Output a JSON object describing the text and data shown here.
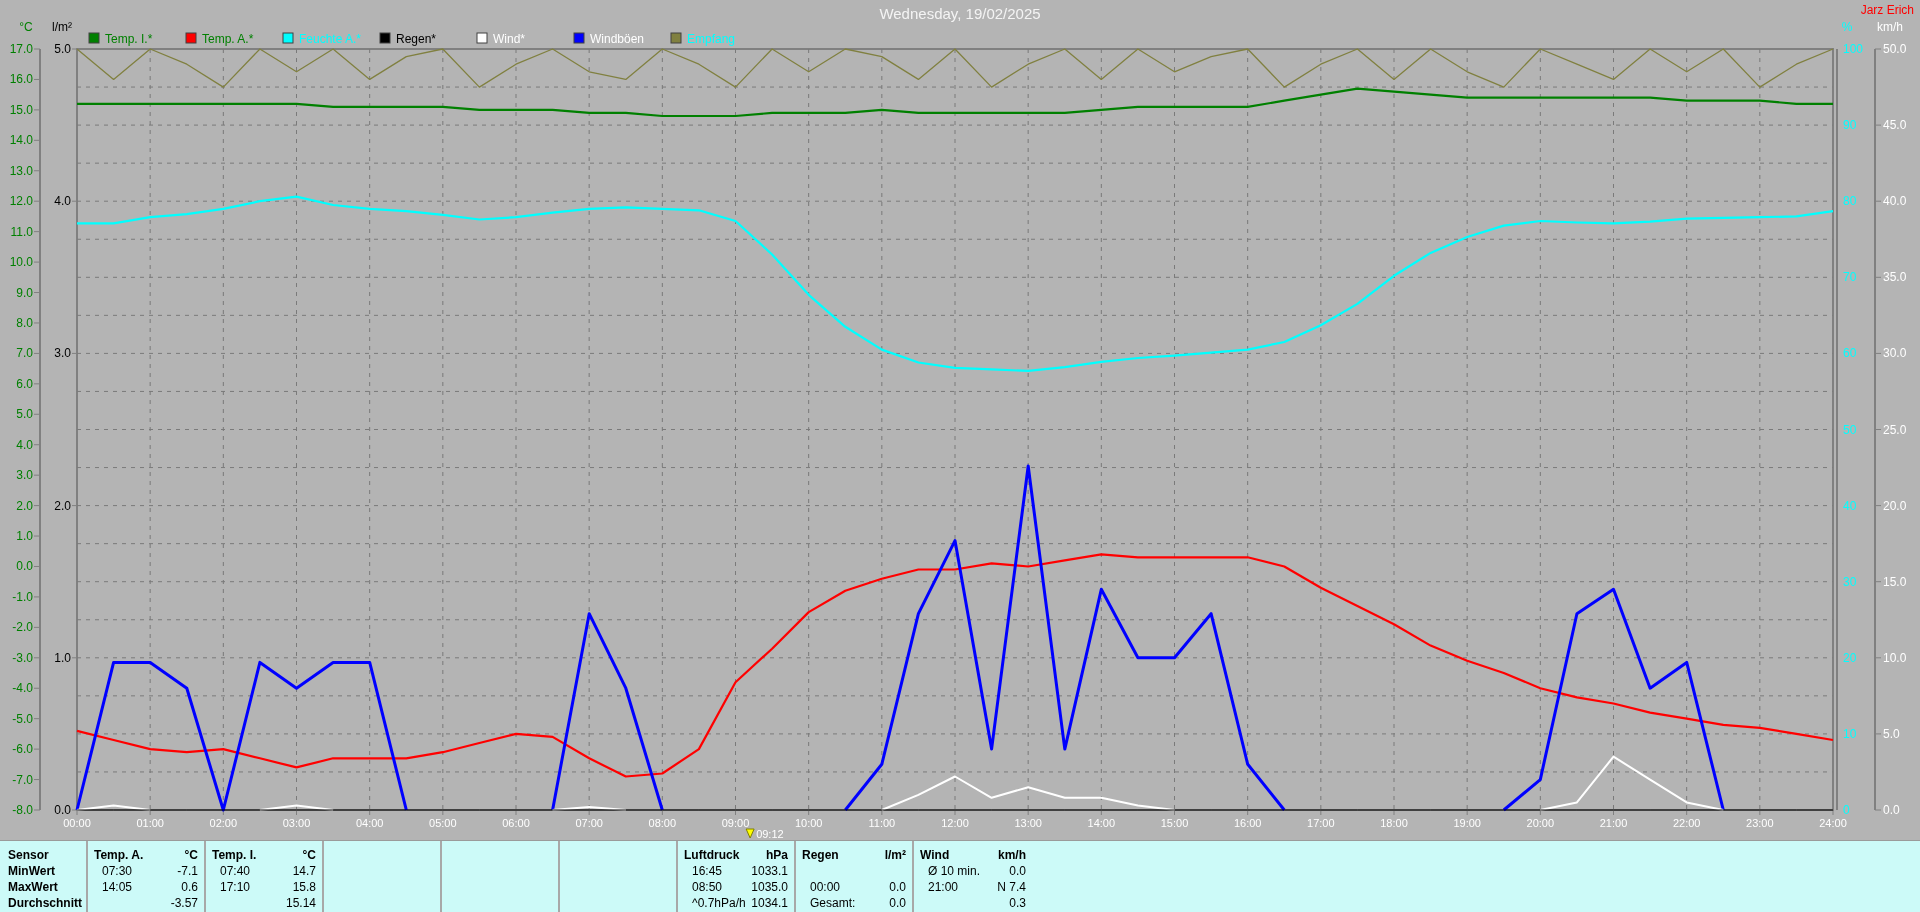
{
  "title": "Wednesday, 19/02/2025",
  "author": "Jarz Erich",
  "chart": {
    "legend": [
      {
        "color": "#008000"
      },
      {
        "color": "#008000"
      },
      {
        "color": "#00ffff"
      },
      {
        "color": "#000000"
      },
      {
        "color": "#ffffff"
      },
      {
        "color": "#ffffff"
      },
      {
        "color": "#00ffff"
      }
    ],
    "rain_axis": {
      "label": "l/m²",
      "ticks": [
        "5.0",
        "4.0",
        "3.0",
        "2.0",
        "1.0",
        "0.0"
      ]
    },
    "chart_data": {
      "type": "line",
      "ylabel": "°C",
      "ylim": [
        -8,
        17
      ],
      "yticks": [
        {
          "value": 17,
          "label": "17.0"
        },
        {
          "value": 16,
          "label": "16.0"
        },
        {
          "value": 15,
          "label": "15.0"
        },
        {
          "value": 14,
          "label": "14.0"
        },
        {
          "value": 13,
          "label": "13.0"
        },
        {
          "value": 12,
          "label": "12.0"
        },
        {
          "value": 11,
          "label": "11.0"
        },
        {
          "value": 10,
          "label": "10.0"
        },
        {
          "value": 9,
          "label": "9.0"
        },
        {
          "value": 8,
          "label": "8.0"
        },
        {
          "value": 7,
          "label": "7.0"
        },
        {
          "value": 6,
          "label": "6.0"
        },
        {
          "value": 5,
          "label": "5.0"
        },
        {
          "value": 4,
          "label": "4.0"
        },
        {
          "value": 3,
          "label": "3.0"
        },
        {
          "value": 2,
          "label": "2.0"
        },
        {
          "value": 1,
          "label": "1.0"
        },
        {
          "value": 0,
          "label": "0.0"
        },
        {
          "value": -1,
          "label": "-1.0"
        },
        {
          "value": -2,
          "label": "-2.0"
        },
        {
          "value": -3,
          "label": "-3.0"
        },
        {
          "value": -4,
          "label": "-4.0"
        },
        {
          "value": -5,
          "label": "-5.0"
        },
        {
          "value": -6,
          "label": "-6.0"
        },
        {
          "value": -7,
          "label": "-7.0"
        },
        {
          "value": -8,
          "label": "-8.0"
        }
      ],
      "y2label": "%",
      "y2lim": [
        0,
        100
      ],
      "y2ticks": [
        {
          "value": 100,
          "label": "100"
        },
        {
          "value": 90,
          "label": "90"
        },
        {
          "value": 80,
          "label": "80"
        },
        {
          "value": 70,
          "label": "70"
        },
        {
          "value": 60,
          "label": "60"
        },
        {
          "value": 50,
          "label": "50"
        },
        {
          "value": 40,
          "label": "40"
        },
        {
          "value": 30,
          "label": "30"
        },
        {
          "value": 20,
          "label": "20"
        },
        {
          "value": 10,
          "label": "10"
        },
        {
          "value": 0,
          "label": "0"
        }
      ],
      "y3label": "km/h",
      "y3lim": [
        0,
        50
      ],
      "y3ticks": [
        {
          "value": 50,
          "label": "50.0"
        },
        {
          "value": 45,
          "label": "45.0"
        },
        {
          "value": 40,
          "label": "40.0"
        },
        {
          "value": 35,
          "label": "35.0"
        },
        {
          "value": 30,
          "label": "30.0"
        },
        {
          "value": 25,
          "label": "25.0"
        },
        {
          "value": 20,
          "label": "20.0"
        },
        {
          "value": 15,
          "label": "15.0"
        },
        {
          "value": 10,
          "label": "10.0"
        },
        {
          "value": 5,
          "label": "5.0"
        },
        {
          "value": 0,
          "label": "0.0"
        }
      ],
      "xlim": [
        0,
        24
      ],
      "xticks": [
        {
          "value": 0,
          "label": "00:00"
        },
        {
          "value": 1,
          "label": "01:00"
        },
        {
          "value": 2,
          "label": "02:00"
        },
        {
          "value": 3,
          "label": "03:00"
        },
        {
          "value": 4,
          "label": "04:00"
        },
        {
          "value": 5,
          "label": "05:00"
        },
        {
          "value": 6,
          "label": "06:00"
        },
        {
          "value": 7,
          "label": "07:00"
        },
        {
          "value": 8,
          "label": "08:00"
        },
        {
          "value": 9,
          "label": "09:00"
        },
        {
          "value": 10,
          "label": "10:00"
        },
        {
          "value": 11,
          "label": "11:00"
        },
        {
          "value": 12,
          "label": "12:00"
        },
        {
          "value": 13,
          "label": "13:00"
        },
        {
          "value": 14,
          "label": "14:00"
        },
        {
          "value": 15,
          "label": "15:00"
        },
        {
          "value": 16,
          "label": "16:00"
        },
        {
          "value": 17,
          "label": "17:00"
        },
        {
          "value": 18,
          "label": "18:00"
        },
        {
          "value": 19,
          "label": "19:00"
        },
        {
          "value": 20,
          "label": "20:00"
        },
        {
          "value": 21,
          "label": "21:00"
        },
        {
          "value": 22,
          "label": "22:00"
        },
        {
          "value": 23,
          "label": "23:00"
        },
        {
          "value": 24,
          "label": "24:00"
        }
      ],
      "x": [
        0,
        0.5,
        1,
        1.5,
        2,
        2.5,
        3,
        3.5,
        4,
        4.5,
        5,
        5.5,
        6,
        6.5,
        7,
        7.5,
        8,
        8.5,
        9,
        9.5,
        10,
        10.5,
        11,
        11.5,
        12,
        12.5,
        13,
        13.5,
        14,
        14.5,
        15,
        15.5,
        16,
        16.5,
        17,
        17.5,
        18,
        18.5,
        19,
        19.5,
        20,
        20.5,
        21,
        21.5,
        22,
        22.5,
        23,
        23.5,
        24
      ],
      "series": [
        {
          "name": "Temp. I.*",
          "color": "#008000",
          "values": [
            15.2,
            15.2,
            15.2,
            15.2,
            15.2,
            15.2,
            15.2,
            15.1,
            15.1,
            15.1,
            15.1,
            15.0,
            15.0,
            15.0,
            14.9,
            14.9,
            14.8,
            14.8,
            14.8,
            14.9,
            14.9,
            14.9,
            15.0,
            14.9,
            14.9,
            14.9,
            14.9,
            14.9,
            15.0,
            15.1,
            15.1,
            15.1,
            15.1,
            15.3,
            15.5,
            15.7,
            15.6,
            15.5,
            15.4,
            15.4,
            15.4,
            15.4,
            15.4,
            15.4,
            15.3,
            15.3,
            15.3,
            15.2,
            15.2
          ]
        },
        {
          "name": "Temp. A.*",
          "color": "#ff0000",
          "values": [
            -5.4,
            -5.7,
            -6.0,
            -6.1,
            -6.0,
            -6.3,
            -6.6,
            -6.3,
            -6.3,
            -6.3,
            -6.1,
            -5.8,
            -5.5,
            -5.6,
            -6.3,
            -6.9,
            -6.8,
            -6.0,
            -3.8,
            -2.7,
            -1.5,
            -0.8,
            -0.4,
            -0.1,
            -0.1,
            0.1,
            0.0,
            0.2,
            0.4,
            0.3,
            0.3,
            0.3,
            0.3,
            0.0,
            -0.7,
            -1.3,
            -1.9,
            -2.6,
            -3.1,
            -3.5,
            -4.0,
            -4.3,
            -4.5,
            -4.8,
            -5.0,
            -5.2,
            -5.3,
            -5.5,
            -5.7
          ]
        },
        {
          "name": "Feuchte A.*",
          "color": "#00ffff",
          "axis": "y2",
          "values": [
            77.1,
            77.1,
            77.9,
            78.3,
            79.0,
            80.0,
            80.6,
            79.5,
            79.0,
            78.7,
            78.2,
            77.6,
            77.9,
            78.5,
            79.0,
            79.2,
            79.0,
            78.8,
            77.4,
            73.0,
            67.7,
            63.5,
            60.5,
            58.8,
            58.1,
            57.9,
            57.7,
            58.2,
            58.9,
            59.4,
            59.7,
            60.1,
            60.5,
            61.5,
            63.7,
            66.5,
            70.2,
            73.2,
            75.3,
            76.8,
            77.4,
            77.2,
            77.1,
            77.3,
            77.7,
            77.8,
            77.9,
            78.0,
            78.7
          ]
        },
        {
          "name": "Regen*",
          "color": "#000000",
          "axis": "y3",
          "values": [
            0,
            0,
            0,
            0,
            0,
            0,
            0,
            0,
            0,
            0,
            0,
            0,
            0,
            0,
            0,
            0,
            0,
            0,
            0,
            0,
            0,
            0,
            0,
            0,
            0,
            0,
            0,
            0,
            0,
            0,
            0,
            0,
            0,
            0,
            0,
            0,
            0,
            0,
            0,
            0,
            0,
            0,
            0,
            0,
            0,
            0,
            0,
            0,
            0
          ]
        },
        {
          "name": "Wind*",
          "color": "#ffffff",
          "axis": "y3",
          "values": [
            0,
            0.3,
            0,
            null,
            null,
            0,
            0.3,
            0,
            null,
            null,
            null,
            null,
            null,
            0,
            0.2,
            0,
            null,
            null,
            null,
            null,
            null,
            null,
            0,
            1,
            2.2,
            0.8,
            1.5,
            0.8,
            0.8,
            0.3,
            0,
            null,
            null,
            null,
            null,
            null,
            null,
            null,
            null,
            null,
            0,
            0.5,
            3.5,
            2,
            0.5,
            0,
            null,
            null,
            null
          ]
        },
        {
          "name": "Windböen",
          "color": "#0000ff",
          "axis": "y3",
          "values": [
            0,
            9.7,
            9.7,
            8,
            0,
            9.7,
            8,
            9.7,
            9.7,
            0,
            null,
            null,
            null,
            0,
            12.9,
            8,
            0,
            null,
            null,
            null,
            null,
            0,
            3,
            12.9,
            17.7,
            4,
            22.6,
            4,
            14.5,
            10,
            10,
            12.9,
            3,
            0,
            null,
            null,
            null,
            null,
            null,
            0,
            2,
            12.9,
            14.5,
            8,
            9.7,
            0,
            null,
            null,
            null
          ]
        },
        {
          "name": "Empfang",
          "color": "#808040",
          "axis": "y2",
          "values": [
            100,
            96,
            100,
            98,
            95,
            100,
            97,
            100,
            96,
            99,
            100,
            95,
            98,
            100,
            97,
            96,
            100,
            98,
            95,
            100,
            97,
            100,
            99,
            96,
            100,
            95,
            98,
            100,
            96,
            100,
            97,
            99,
            100,
            95,
            98,
            100,
            96,
            100,
            97,
            95,
            100,
            98,
            96,
            100,
            97,
            100,
            95,
            98,
            100
          ]
        }
      ],
      "grid": true,
      "legend": "top",
      "annotations": [
        "09:12"
      ]
    }
  },
  "stats": {
    "row_labels": [
      "Sensor",
      "MinWert",
      "MaxWert",
      "Durchschnitt"
    ],
    "sections": [
      {
        "kind": "data",
        "name": "Temp. A.",
        "unit": "°C",
        "rows": [
          {
            "time": "07:30",
            "value": "-7.1"
          },
          {
            "time": "14:05",
            "value": "0.6"
          },
          {
            "value": "-3.57"
          }
        ]
      },
      {
        "kind": "data",
        "name": "Temp. I.",
        "unit": "°C",
        "rows": [
          {
            "time": "07:40",
            "value": "14.7"
          },
          {
            "time": "17:10",
            "value": "15.8"
          },
          {
            "value": "15.14"
          }
        ]
      },
      {
        "kind": "blank"
      },
      {
        "kind": "blank"
      },
      {
        "kind": "blank"
      },
      {
        "kind": "data",
        "name": "Luftdruck",
        "unit": "hPa",
        "rows": [
          {
            "time": "16:45",
            "value": "1033.1"
          },
          {
            "time": "08:50",
            "value": "1035.0"
          },
          {
            "time": "^0.7hPa/h",
            "value": "1034.1"
          }
        ]
      },
      {
        "kind": "data",
        "name": "Regen",
        "unit": "l/m²",
        "rows": [
          null,
          {
            "time": "00:00",
            "value": "0.0"
          },
          {
            "time": "Gesamt:",
            "value": "0.0"
          }
        ]
      },
      {
        "kind": "data",
        "name": "Wind",
        "unit": "km/h",
        "rows": [
          {
            "time": "Ø 10 min.",
            "value": "0.0"
          },
          {
            "time": "21:00",
            "value": "N 7.4"
          },
          {
            "value": "0.3"
          }
        ]
      }
    ]
  }
}
